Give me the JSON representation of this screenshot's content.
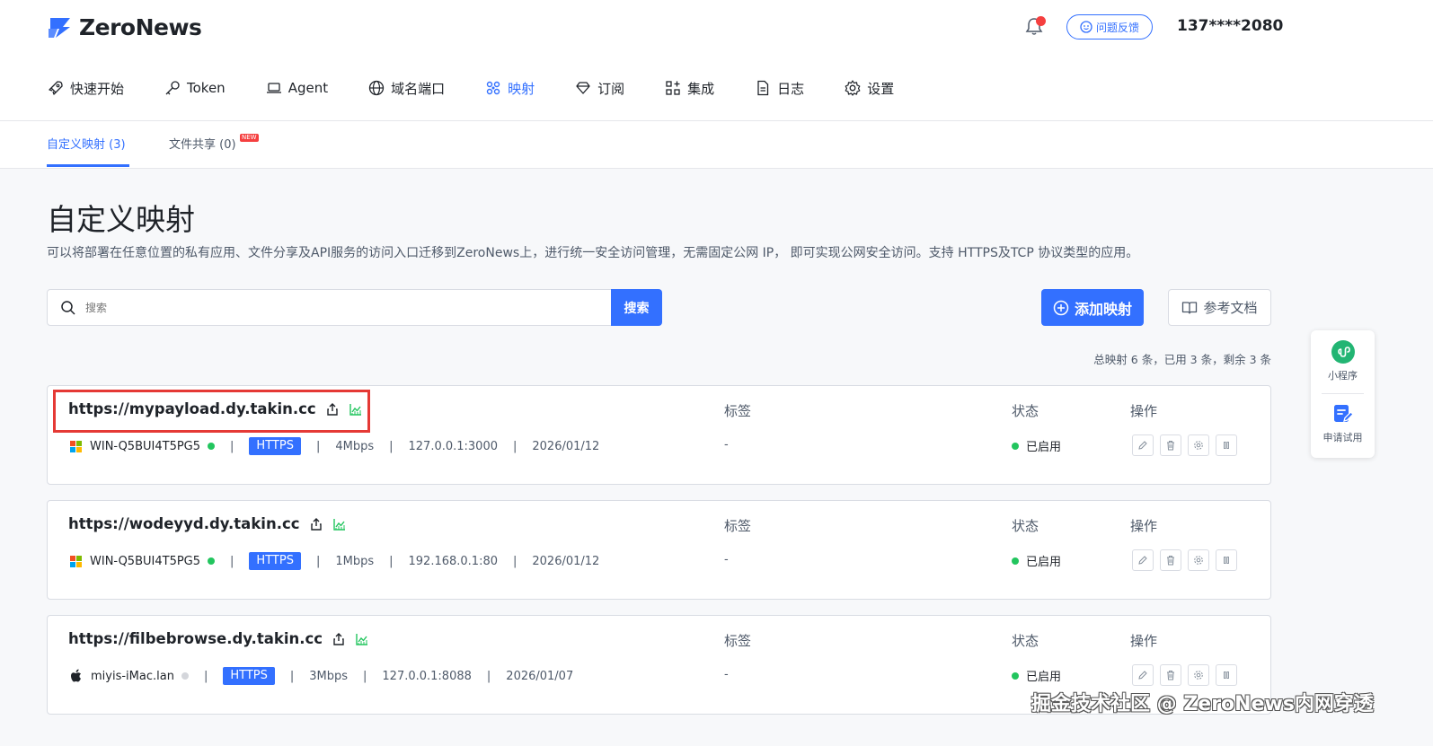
{
  "app": {
    "name": "ZeroNews"
  },
  "header": {
    "feedback_label": "问题反馈",
    "user": "137****2080"
  },
  "nav": [
    {
      "label": "快速开始",
      "icon": "rocket-icon"
    },
    {
      "label": "Token",
      "icon": "key-icon"
    },
    {
      "label": "Agent",
      "icon": "laptop-icon"
    },
    {
      "label": "域名端口",
      "icon": "globe-icon"
    },
    {
      "label": "映射",
      "icon": "mapping-icon",
      "active": true
    },
    {
      "label": "订阅",
      "icon": "diamond-icon"
    },
    {
      "label": "集成",
      "icon": "apps-icon"
    },
    {
      "label": "日志",
      "icon": "document-icon"
    },
    {
      "label": "设置",
      "icon": "gear-icon"
    }
  ],
  "subtabs": {
    "custom": "自定义映射 (3)",
    "share": "文件共享 (0)",
    "new_badge": "NEW"
  },
  "page": {
    "title": "自定义映射",
    "description": "可以将部署在任意位置的私有应用、文件分享及API服务的访问入口迁移到ZeroNews上，进行统一安全访问管理，无需固定公网 IP， 即可实现公网安全访问。支持 HTTPS及TCP 协议类型的应用。"
  },
  "search": {
    "placeholder": "搜索",
    "button": "搜索"
  },
  "actions": {
    "add": "添加映射",
    "docs": "参考文档"
  },
  "quota": "总映射 6 条，已用 3 条，剩余 3 条",
  "columns": {
    "tags": "标签",
    "status": "状态",
    "ops": "操作"
  },
  "mappings": [
    {
      "url": "https://mypayload.dy.takin.cc",
      "os": "windows",
      "host": "WIN-Q5BUI4T5PG5",
      "online": true,
      "protocol": "HTTPS",
      "bandwidth": "4Mbps",
      "target": "127.0.0.1:3000",
      "date": "2026/01/12",
      "tags": "-",
      "status": "已启用"
    },
    {
      "url": "https://wodeyyd.dy.takin.cc",
      "os": "windows",
      "host": "WIN-Q5BUI4T5PG5",
      "online": true,
      "protocol": "HTTPS",
      "bandwidth": "1Mbps",
      "target": "192.168.0.1:80",
      "date": "2026/01/12",
      "tags": "-",
      "status": "已启用"
    },
    {
      "url": "https://filbebrowse.dy.takin.cc",
      "os": "apple",
      "host": "miyis-iMac.lan",
      "online": false,
      "protocol": "HTTPS",
      "bandwidth": "3Mbps",
      "target": "127.0.0.1:8088",
      "date": "2026/01/07",
      "tags": "-",
      "status": "已启用"
    }
  ],
  "side": {
    "miniapp": "小程序",
    "trial": "申请试用"
  },
  "watermark": "掘金技术社区 @ ZeroNews内网穿透",
  "colors": {
    "accent": "#3370ff",
    "online": "#22c55e",
    "highlight": "#e53935"
  }
}
